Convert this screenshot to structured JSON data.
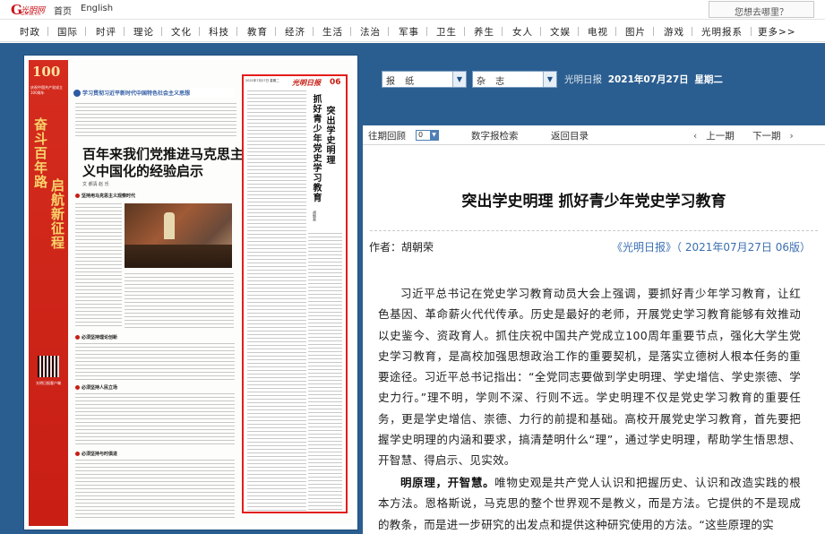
{
  "topbar": {
    "logo_mark": "光明网",
    "logo_sub": "GMW.cn",
    "home_label": "首页",
    "english_label": "English",
    "search_placeholder": "您想去哪里？"
  },
  "nav": {
    "items": [
      "时政",
      "国际",
      "时评",
      "理论",
      "文化",
      "科技",
      "教育",
      "经济",
      "生活",
      "法治",
      "军事",
      "卫生",
      "养生",
      "女人",
      "文娱",
      "电视",
      "图片",
      "游戏",
      "光明报系",
      "更多>>"
    ]
  },
  "paper_page": {
    "strip_number": "100",
    "strip_caption": "庆祝中国共产党成立100周年",
    "strip_vertical_1": "奋斗百年路",
    "strip_vertical_2": "启航新征程",
    "section_header": "学习贯彻习近平新时代中国特色社会主义思想",
    "headline": "百年来我们党推进马克思主义中国化的经验启示",
    "byline": "文 郝清 赵 乐",
    "sub_heads": [
      "坚持用马克思主义观察时代",
      "必须坚持理论创新",
      "必须坚持人民立场",
      "必须坚持与时俱进"
    ],
    "qr_caption": "光明日报客户端",
    "column_date": "2021年7月27日 星期二",
    "column_masthead": "光明日报",
    "column_page": "06",
    "column_title_1": "突出学史明理",
    "column_title_2": "抓好青少年党史学习教育",
    "column_author": "胡朝荣"
  },
  "selectors": {
    "newspaper_type": "报 纸",
    "magazine_type": "杂 志",
    "paper_name": "光明日报",
    "date": "2021年07月27日",
    "weekday": "星期二"
  },
  "toolbar": {
    "past_issues": "往期回顾",
    "past_issues_value": "0",
    "digital_search": "数字报检索",
    "back_to_toc": "返回目录",
    "prev_page": "上一期",
    "next_page": "下一期"
  },
  "article": {
    "title": "突出学史明理 抓好青少年党史学习教育",
    "author": "作者：胡朝荣",
    "source": "《光明日报》（ 2021年07月27日 06版）",
    "p1": "习近平总书记在党史学习教育动员大会上强调，要抓好青少年学习教育，让红色基因、革命薪火代代传承。历史是最好的老师，开展党史学习教育能够有效推动以史鉴今、资政育人。抓住庆祝中国共产党成立100周年重要节点，强化大学生党史学习教育，是高校加强思想政治工作的重要契机，是落实立德树人根本任务的重要途径。习近平总书记指出：“全党同志要做到学史明理、学史增信、学史崇德、学史力行。”理不明，学则不深、行则不远。学史明理不仅是党史学习教育的重要任务，更是学史增信、崇德、力行的前提和基础。高校开展党史学习教育，首先要把握学史明理的内涵和要求，搞清楚明什么“理”，通过学史明理，帮助学生悟思想、开智慧、得启示、见实效。",
    "p2_lead": "明原理，开智慧。",
    "p2": "唯物史观是共产党人认识和把握历史、认识和改造实践的根本方法。恩格斯说，马克思的整个世界观不是教义，而是方法。它提供的不是现成的教条，而是进一步研究的出发点和提供这种研究使用的方法。“这些原理的实"
  },
  "colors": {
    "band_blue": "#2b5e90",
    "accent_red": "#c81e14",
    "link_blue": "#3a6fb0"
  }
}
